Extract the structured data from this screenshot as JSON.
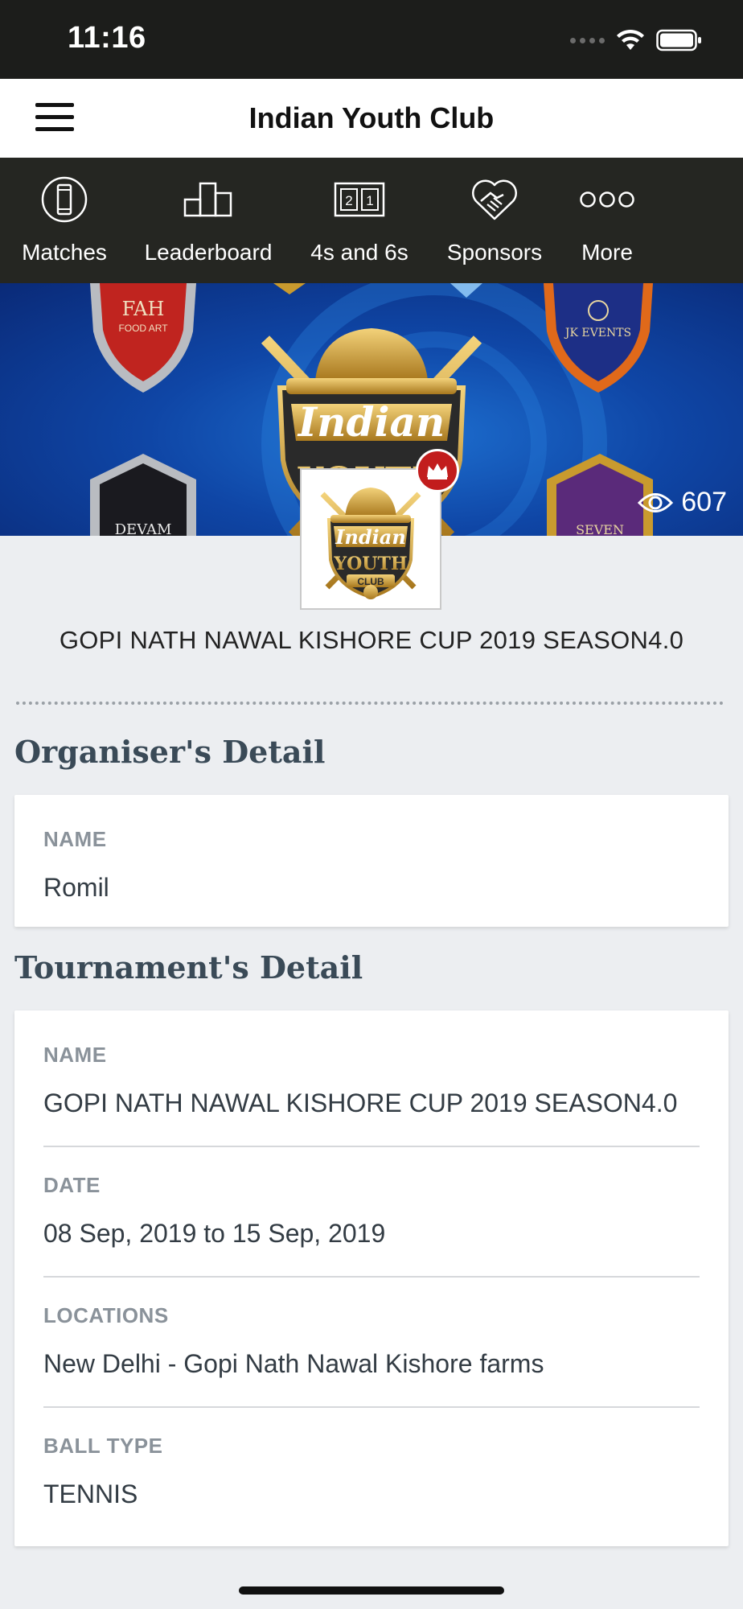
{
  "status_bar": {
    "time": "11:16"
  },
  "header": {
    "title": "Indian Youth Club"
  },
  "tabs": [
    {
      "label": "Matches",
      "icon": "cricket-pitch-icon"
    },
    {
      "label": "Leaderboard",
      "icon": "leaderboard-icon"
    },
    {
      "label": "4s and 6s",
      "icon": "scoreboard-icon"
    },
    {
      "label": "Sponsors",
      "icon": "handshake-heart-icon"
    },
    {
      "label": "More",
      "icon": "more-dots-icon"
    }
  ],
  "banner": {
    "views": "607",
    "logo_text": {
      "line1": "Indian",
      "line2": "YOUTH",
      "line3": "CLUB"
    },
    "sponsor_shields": [
      "FAH",
      "FOOD ART",
      "JK EVENTS",
      "DEVAM",
      "SEVEN"
    ]
  },
  "tournament_title": "GOPI NATH NAWAL KISHORE CUP 2019 SEASON4.0",
  "organiser": {
    "heading": "Organiser's Detail",
    "fields": [
      {
        "label": "NAME",
        "value": "Romil"
      }
    ]
  },
  "tournament": {
    "heading": "Tournament's Detail",
    "fields": [
      {
        "label": "NAME",
        "value": "GOPI NATH NAWAL KISHORE CUP 2019 SEASON4.0"
      },
      {
        "label": "DATE",
        "value": "08 Sep, 2019 to 15 Sep, 2019"
      },
      {
        "label": "LOCATIONS",
        "value": "New Delhi - Gopi Nath Nawal Kishore farms"
      },
      {
        "label": "BALL TYPE",
        "value": "TENNIS"
      }
    ]
  },
  "colors": {
    "tab_bar": "#252622",
    "status_bar": "#1c1d1b",
    "banner_blue": "#0f46a6",
    "badge_red": "#c21d1d",
    "gold": "#c99a2e"
  }
}
